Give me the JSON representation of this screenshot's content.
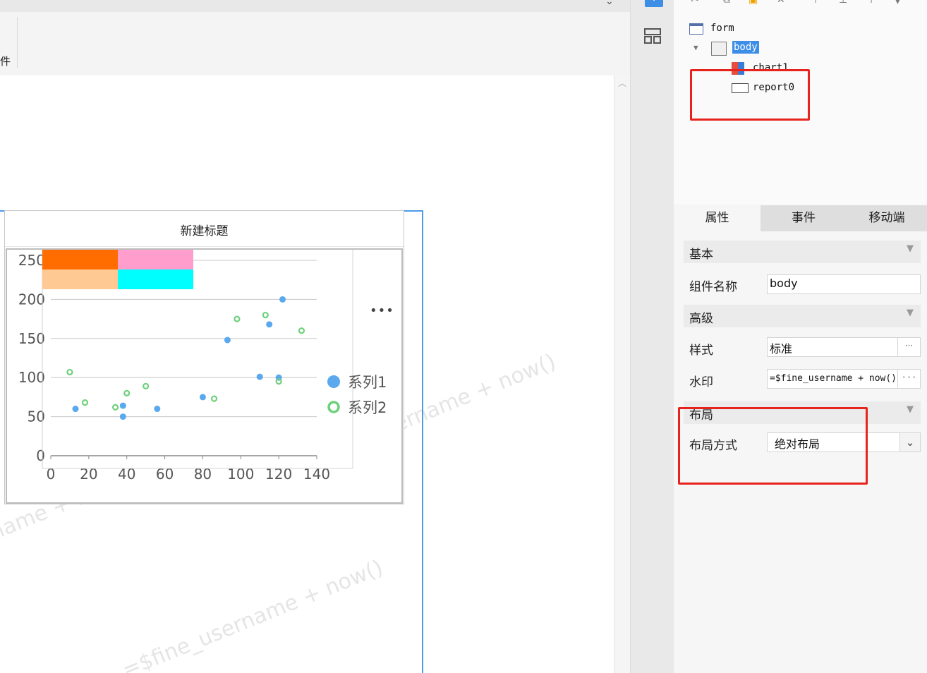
{
  "toolbar": {
    "fragment_label": "件"
  },
  "canvas": {
    "watermark_text": "=$fine_username + now()",
    "chart": {
      "title": "新建标题",
      "more_label": "•••"
    }
  },
  "tree": {
    "items": [
      {
        "label": "form"
      },
      {
        "label": "body"
      },
      {
        "label": "chart1"
      },
      {
        "label": "report0"
      }
    ]
  },
  "tabs": [
    {
      "label": "属性"
    },
    {
      "label": "事件"
    },
    {
      "label": "移动端"
    }
  ],
  "sections": {
    "basic": "基本",
    "advanced": "高级",
    "layout": "布局"
  },
  "props": {
    "widget_name_label": "组件名称",
    "widget_name_value": "body",
    "style_label": "样式",
    "style_value": "标准",
    "watermark_label": "水印",
    "watermark_value": "=$fine_username + now()",
    "layout_mode_label": "布局方式",
    "layout_mode_value": "绝对布局",
    "ellipsis": "···"
  },
  "chart_data": {
    "type": "scatter",
    "title": "新建标题",
    "xlim": [
      0,
      140
    ],
    "ylim": [
      0,
      250
    ],
    "x_ticks": [
      0,
      20,
      40,
      60,
      80,
      100,
      120,
      140
    ],
    "y_ticks": [
      0,
      50,
      100,
      150,
      200,
      250
    ],
    "grid": true,
    "legend_position": "right",
    "series": [
      {
        "name": "系列1",
        "color": "#5aa9ee",
        "marker": "filled-circle",
        "points": [
          [
            13,
            60
          ],
          [
            38,
            64
          ],
          [
            38,
            50
          ],
          [
            56,
            60
          ],
          [
            80,
            75
          ],
          [
            93,
            148
          ],
          [
            110,
            101
          ],
          [
            115,
            168
          ],
          [
            120,
            100
          ],
          [
            122,
            200
          ]
        ]
      },
      {
        "name": "系列2",
        "color": "#6fd07c",
        "marker": "hollow-circle",
        "points": [
          [
            10,
            107
          ],
          [
            18,
            68
          ],
          [
            34,
            62
          ],
          [
            40,
            80
          ],
          [
            50,
            89
          ],
          [
            86,
            73
          ],
          [
            98,
            175
          ],
          [
            113,
            180
          ],
          [
            120,
            95
          ],
          [
            132,
            160
          ]
        ]
      }
    ],
    "overlay_swatches": [
      "#ff6d00",
      "#ff9ecd",
      "#ffc993",
      "#00fefe"
    ]
  }
}
